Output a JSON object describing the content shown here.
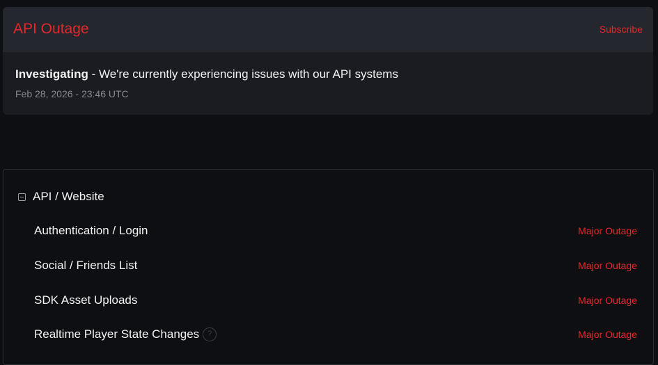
{
  "incident": {
    "title": "API Outage",
    "subscribe_label": "Subscribe",
    "update": {
      "status": "Investigating",
      "separator": " - ",
      "message": "We're currently experiencing issues with our API systems",
      "timestamp": "Feb 28, 2026 - 23:46 UTC"
    }
  },
  "components": {
    "group_name": "API / Website",
    "items": [
      {
        "name": "Authentication / Login",
        "status": "Major Outage",
        "has_help": false
      },
      {
        "name": "Social / Friends List",
        "status": "Major Outage",
        "has_help": false
      },
      {
        "name": "SDK Asset Uploads",
        "status": "Major Outage",
        "has_help": false
      },
      {
        "name": "Realtime Player State Changes",
        "status": "Major Outage",
        "has_help": true
      }
    ]
  },
  "colors": {
    "background": "#0e0f12",
    "card": "#1a1c21",
    "card_header": "#24272e",
    "outage_red": "#e8262b",
    "text_primary": "#f2f2f2",
    "text_muted": "#868a92"
  },
  "icons": {
    "collapse": "minus-square-icon",
    "help": "question-circle-icon"
  }
}
